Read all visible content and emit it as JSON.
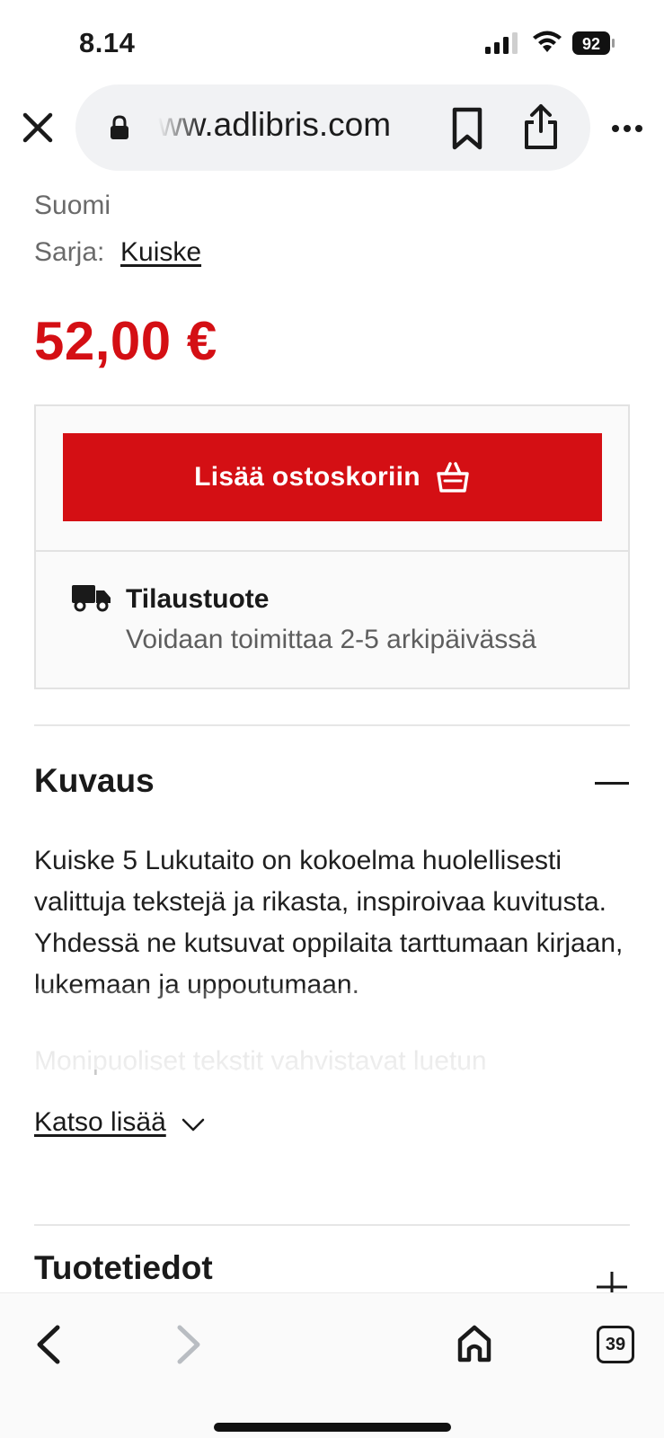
{
  "status_bar": {
    "time": "8.14",
    "battery": "92"
  },
  "browser": {
    "url": "ww.adlibris.com"
  },
  "product": {
    "language": "Suomi",
    "series_label": "Sarja:",
    "series_value": "Kuiske",
    "price": "52,00 €",
    "cart_button": "Lisää ostoskoriin",
    "delivery_title": "Tilaustuote",
    "delivery_sub": "Voidaan toimittaa 2-5 arkipäivässä"
  },
  "description": {
    "title": "Kuvaus",
    "text": "Kuiske 5 Lukutaito on kokoelma huolellisesti valittuja tekstejä ja rikasta, inspiroivaa kuvitusta. Yhdessä ne kutsuvat oppilaita tarttumaan kirjaan, lukemaan ja uppoutumaan.",
    "faded_text": "Monipuoliset tekstit vahvistavat luetun",
    "see_more": "Katso lisää"
  },
  "details": {
    "title": "Tuotetiedot"
  },
  "bottom_bar": {
    "tabs_count": "39"
  }
}
